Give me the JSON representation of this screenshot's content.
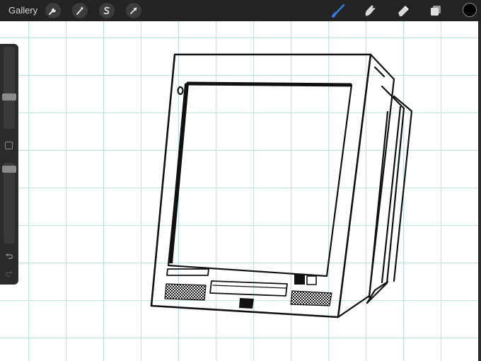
{
  "topbar": {
    "gallery_label": "Gallery",
    "left_tools": [
      {
        "name": "actions",
        "icon": "wrench-icon"
      },
      {
        "name": "adjustments",
        "icon": "magic-wand-icon"
      },
      {
        "name": "selection",
        "icon": "selection-s-icon"
      },
      {
        "name": "transform",
        "icon": "arrow-cursor-icon"
      }
    ],
    "right_tools": [
      {
        "name": "brush",
        "icon": "brush-icon",
        "active": true
      },
      {
        "name": "smudge",
        "icon": "smudge-finger-icon",
        "active": false
      },
      {
        "name": "eraser",
        "icon": "eraser-icon",
        "active": false
      },
      {
        "name": "layers",
        "icon": "layers-icon",
        "active": false
      }
    ],
    "current_color": "#000000",
    "accent_color": "#2f7de1"
  },
  "sidebar": {
    "brush_size_level": 0.55,
    "opacity_level": 0.05,
    "icons": [
      "modify-square-icon",
      "undo-icon",
      "redo-icon"
    ]
  },
  "canvas": {
    "grid_color": "#bfe3df",
    "background": "#ffffff",
    "drawing": "crt-monitor-line-art"
  }
}
